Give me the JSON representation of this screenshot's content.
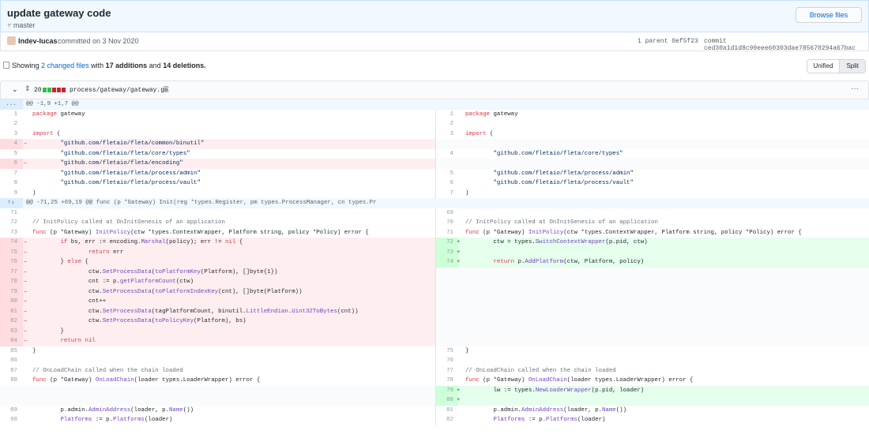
{
  "header": {
    "title": "update gateway code",
    "branch": "master",
    "browse_label": "Browse files"
  },
  "meta": {
    "author": "lndev-lucas",
    "committed": "committed on 3 Nov 2020",
    "parent": "1 parent 0ef5f23",
    "commit": "commit ced30a1d1d8c99eee60303dae785670294a67bac"
  },
  "summary": {
    "showing": "Showing",
    "changed": "2 changed files",
    "with": "with",
    "additions": "17 additions",
    "and": "and",
    "deletions": "14 deletions.",
    "unified": "Unified",
    "split": "Split"
  },
  "file": {
    "count": "20",
    "path": "process/gateway/gateway.go",
    "stat": [
      "add",
      "add",
      "del",
      "del",
      "del"
    ]
  },
  "hunks": [
    {
      "header": "@@ -1,9 +1,7 @@",
      "expand": "..."
    },
    {
      "header": "@@ -71,25 +69,19 @@ func (p *Gateway) Init(reg *types.Register, pm types.ProcessManager, cn types.Pr",
      "expand": "⇡⇣"
    }
  ],
  "rows": [
    {
      "t": "hunk",
      "h": 0
    },
    {
      "t": "ctx",
      "l": "1",
      "lc": "package gateway",
      "r": "1",
      "rc": "package gateway"
    },
    {
      "t": "ctx",
      "l": "2",
      "lc": "",
      "r": "2",
      "rc": ""
    },
    {
      "t": "ctx",
      "l": "3",
      "lc": "import (",
      "r": "3",
      "rc": "import ("
    },
    {
      "t": "del",
      "l": "4",
      "lc": "\t\"github.com/fletaio/fleta/common/binutil\"",
      "r": "",
      "rc": ""
    },
    {
      "t": "ctx",
      "l": "5",
      "lc": "\t\"github.com/fletaio/fleta/core/types\"",
      "r": "4",
      "rc": "\t\"github.com/fletaio/fleta/core/types\""
    },
    {
      "t": "del",
      "l": "6",
      "lc": "\t\"github.com/fletaio/fleta/encoding\"",
      "r": "",
      "rc": ""
    },
    {
      "t": "ctx",
      "l": "7",
      "lc": "\t\"github.com/fletaio/fleta/process/admin\"",
      "r": "5",
      "rc": "\t\"github.com/fletaio/fleta/process/admin\""
    },
    {
      "t": "ctx",
      "l": "8",
      "lc": "\t\"github.com/fletaio/fleta/process/vault\"",
      "r": "6",
      "rc": "\t\"github.com/fletaio/fleta/process/vault\""
    },
    {
      "t": "ctx",
      "l": "9",
      "lc": ")",
      "r": "7",
      "rc": ")"
    },
    {
      "t": "hunk",
      "h": 1
    },
    {
      "t": "ctx",
      "l": "71",
      "lc": "",
      "r": "69",
      "rc": ""
    },
    {
      "t": "ctx",
      "l": "72",
      "lc": "// InitPolicy called at OnInitGenesis of an application",
      "r": "70",
      "rc": "// InitPolicy called at OnInitGenesis of an application"
    },
    {
      "t": "ctx",
      "l": "73",
      "lc": "func (p *Gateway) InitPolicy(ctw *types.ContextWrapper, Platform string, policy *Policy) error {",
      "r": "71",
      "rc": "func (p *Gateway) InitPolicy(ctw *types.ContextWrapper, Platform string, policy *Policy) error {"
    },
    {
      "t": "mod",
      "l": "74",
      "lc": "\tif bs, err := encoding.Marshal(policy); err != nil {",
      "r": "72",
      "rc": "\tctw = types.SwitchContextWrapper(p.pid, ctw)"
    },
    {
      "t": "mod",
      "l": "75",
      "lc": "\t\treturn err",
      "r": "73",
      "rc": ""
    },
    {
      "t": "mod",
      "l": "76",
      "lc": "\t} else {",
      "r": "74",
      "rc": "\treturn p.AddPlatform(ctw, Platform, policy)"
    },
    {
      "t": "del",
      "l": "77",
      "lc": "\t\tctw.SetProcessData(toPlatformKey(Platform), []byte{1})",
      "r": "",
      "rc": ""
    },
    {
      "t": "del",
      "l": "78",
      "lc": "\t\tcnt := p.getPlatformCount(ctw)",
      "r": "",
      "rc": ""
    },
    {
      "t": "del",
      "l": "79",
      "lc": "\t\tctw.SetProcessData(toPlatformIndexKey(cnt), []byte(Platform))",
      "r": "",
      "rc": ""
    },
    {
      "t": "del",
      "l": "80",
      "lc": "\t\tcnt++",
      "r": "",
      "rc": ""
    },
    {
      "t": "del",
      "l": "81",
      "lc": "\t\tctw.SetProcessData(tagPlatformCount, binutil.LittleEndian.Uint32ToBytes(cnt))",
      "r": "",
      "rc": ""
    },
    {
      "t": "del",
      "l": "82",
      "lc": "\t\tctw.SetProcessData(toPolicyKey(Platform), bs)",
      "r": "",
      "rc": ""
    },
    {
      "t": "del",
      "l": "83",
      "lc": "\t}",
      "r": "",
      "rc": ""
    },
    {
      "t": "del",
      "l": "84",
      "lc": "\treturn nil",
      "r": "",
      "rc": ""
    },
    {
      "t": "ctx",
      "l": "85",
      "lc": "}",
      "r": "75",
      "rc": "}"
    },
    {
      "t": "ctx",
      "l": "86",
      "lc": "",
      "r": "76",
      "rc": ""
    },
    {
      "t": "ctx",
      "l": "87",
      "lc": "// OnLoadChain called when the chain loaded",
      "r": "77",
      "rc": "// OnLoadChain called when the chain loaded"
    },
    {
      "t": "ctx",
      "l": "88",
      "lc": "func (p *Gateway) OnLoadChain(loader types.LoaderWrapper) error {",
      "r": "78",
      "rc": "func (p *Gateway) OnLoadChain(loader types.LoaderWrapper) error {"
    },
    {
      "t": "add",
      "l": "",
      "lc": "",
      "r": "79",
      "rc": "\tlw := types.NewLoaderWrapper(p.pid, loader)"
    },
    {
      "t": "add",
      "l": "",
      "lc": "",
      "r": "80",
      "rc": ""
    },
    {
      "t": "ctx",
      "l": "89",
      "lc": "\tp.admin.AdminAddress(loader, p.Name())",
      "r": "81",
      "rc": "\tp.admin.AdminAddress(loader, p.Name())"
    },
    {
      "t": "ctx",
      "l": "90",
      "lc": "\tPlatforms := p.Platforms(loader)",
      "r": "82",
      "rc": "\tPlatforms := p.Platforms(loader)"
    }
  ]
}
